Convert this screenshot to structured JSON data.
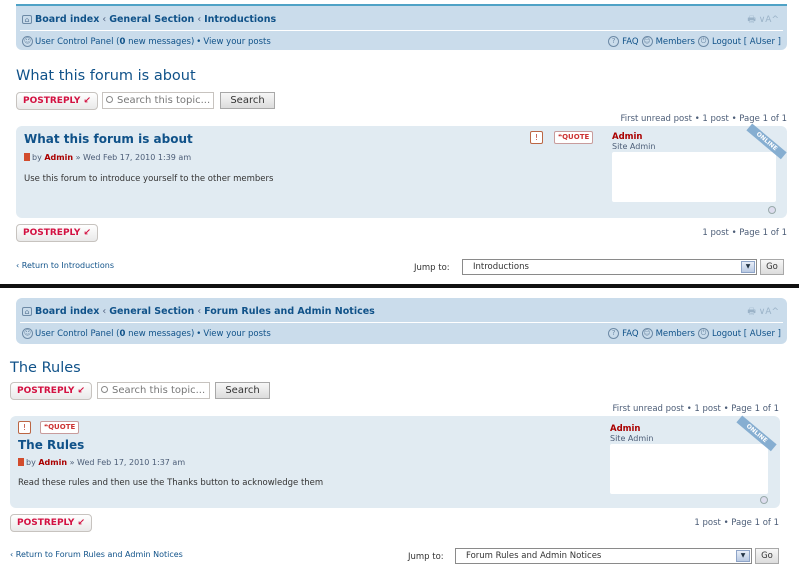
{
  "panels": [
    {
      "navbar": {
        "crumbs": [
          "Board index",
          "General Section",
          "Introductions"
        ],
        "ucp_prefix": "User Control Panel (",
        "new_count": "0",
        "ucp_suffix": " new messages)",
        "bullet": "•",
        "view_posts": "View your posts",
        "faq": "FAQ",
        "members": "Members",
        "logout": "Logout [ AUser ]",
        "tools": "🖶 ∨A^"
      },
      "title": "What this forum is about",
      "post_reply": "POSTREPLY",
      "search_placeholder": "Search this topic...",
      "search_button": "Search",
      "pagination_top": "First unread post • 1 post • Page 1 of 1",
      "post": {
        "title": "What this forum is about",
        "by": "by",
        "author": "Admin",
        "date": "» Wed Feb 17, 2010 1:39 am",
        "content": "Use this forum to introduce yourself to the other members",
        "quote": "QUOTE",
        "profile_name": "Admin",
        "profile_rank": "Site Admin",
        "online": "ONLINE"
      },
      "pagination_bottom": "1 post • Page 1 of 1",
      "return_link": "Return to Introductions",
      "jump_label": "Jump to:",
      "jump_value": "Introductions",
      "go": "Go"
    },
    {
      "navbar": {
        "crumbs": [
          "Board index",
          "General Section",
          "Forum Rules and Admin Notices"
        ],
        "ucp_prefix": "User Control Panel (",
        "new_count": "0",
        "ucp_suffix": " new messages)",
        "bullet": "•",
        "view_posts": "View your posts",
        "faq": "FAQ",
        "members": "Members",
        "logout": "Logout [ AUser ]",
        "tools": "🖶 ∨A^"
      },
      "title": "The Rules",
      "post_reply": "POSTREPLY",
      "search_placeholder": "Search this topic...",
      "search_button": "Search",
      "pagination_top": "First unread post • 1 post • Page 1 of 1",
      "post": {
        "title": "The Rules",
        "by": "by",
        "author": "Admin",
        "date": "» Wed Feb 17, 2010 1:37 am",
        "content": "Read these rules and then use the Thanks button to acknowledge them",
        "quote": "QUOTE",
        "profile_name": "Admin",
        "profile_rank": "Site Admin",
        "online": "ONLINE"
      },
      "pagination_bottom": "1 post • Page 1 of 1",
      "return_link": "Return to Forum Rules and Admin Notices",
      "jump_label": "Jump to:",
      "jump_value": "Forum Rules and Admin Notices",
      "go": "Go"
    }
  ]
}
